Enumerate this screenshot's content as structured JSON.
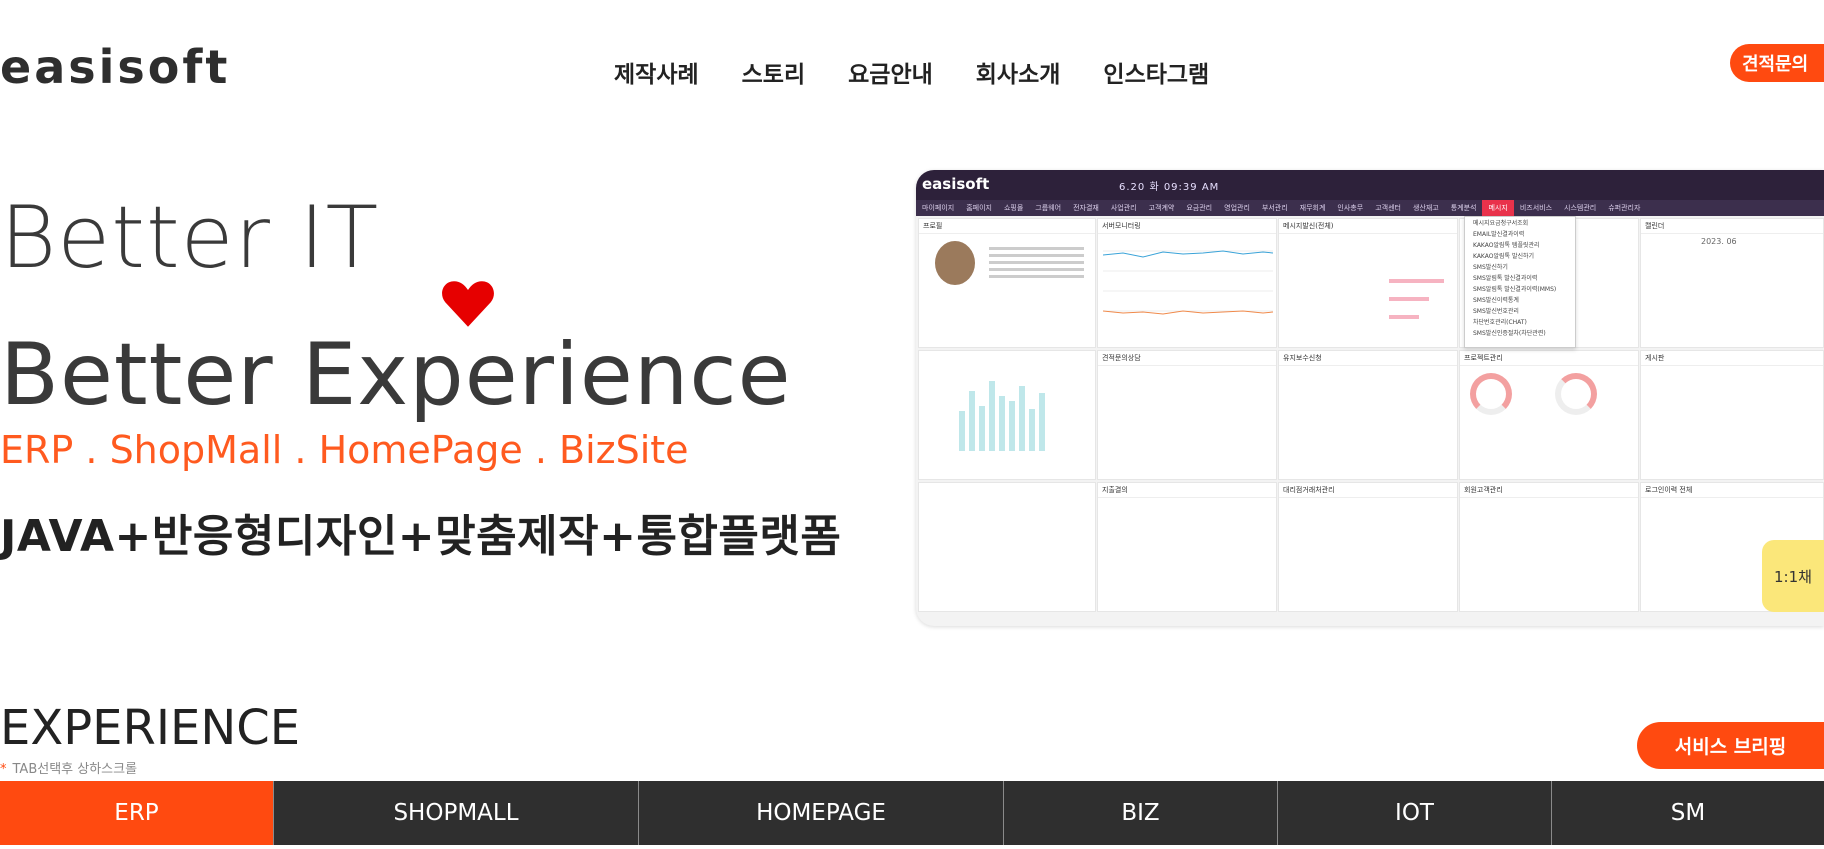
{
  "brand": {
    "logo": "easisoft"
  },
  "nav": [
    "제작사례",
    "스토리",
    "요금안내",
    "회사소개",
    "인스타그램"
  ],
  "quote_button": "견적문의",
  "hero": {
    "line1": "Better IT",
    "line2": "Better Experience",
    "tagline": "ERP . ShopMall . HomePage . BizSite",
    "stack": "JAVA+반응형디자인+맞춤제작+통합플랫폼"
  },
  "preview": {
    "logo": "easisoft",
    "time": "6.20 화 09:39 AM",
    "menu": [
      "마이페이지",
      "홈페이지",
      "쇼핑몰",
      "그룹웨어",
      "전자결재",
      "사업관리",
      "고객계약",
      "요금관리",
      "영업관리",
      "부서관리",
      "재무회계",
      "인사총무",
      "고객센터",
      "생산재고",
      "통계분석",
      "메시지",
      "비즈서비스",
      "시스템관리",
      "슈퍼관리자"
    ],
    "active_menu": "메시지",
    "panels": [
      "프로필",
      "서버모니터링",
      "메시지발신(전체)",
      "캘린더",
      "견적문의상담",
      "유지보수신청",
      "프로젝트관리",
      "게시판",
      "지출결의",
      "대리점거래처관리",
      "회원고객관리",
      "로그인이력 전체"
    ],
    "dropdown": [
      "메시지요금청구서조회",
      "EMAIL발신결과이력",
      "KAKAO알림톡 템플릿관리",
      "KAKAO알림톡 발신하기",
      "SMS발신하기",
      "SMS알림톡 발신결과이력",
      "SMS알림톡 발신결과이력(MMS)",
      "SMS발신이력통계",
      "SMS발신번호관리",
      "차단번호관리(CHAT)",
      "SMS발신인증절차(차단관련)"
    ],
    "calendar_title": "2023. 06",
    "chat_label": "1:1채"
  },
  "experience": {
    "title": "EXPERIENCE",
    "hint": "TAB선택후 상하스크롤",
    "brief_button": "서비스 브리핑",
    "tabs": [
      "ERP",
      "SHOPMALL",
      "HOMEPAGE",
      "BIZ",
      "IOT",
      "SM"
    ],
    "active_tab": "ERP"
  },
  "colors": {
    "accent": "#ff4a10",
    "tagline": "#ff5a1f",
    "tab_bar": "#2f2f2f",
    "heart": "#e60000",
    "preview_header": "#2d213a"
  }
}
